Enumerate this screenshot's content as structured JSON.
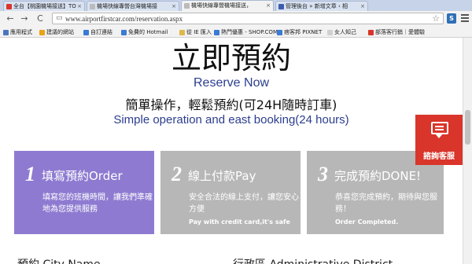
{
  "tabs": [
    {
      "label": "全台【桃園機場接送】TO",
      "color": "#d9352b"
    },
    {
      "label": "機場快線專營台灣機場接",
      "color": "#7a7a7a"
    },
    {
      "label": "機場快線專營機場接送，",
      "color": "#7a7a7a"
    },
    {
      "label": "管理後台 » 新增文章 ‹ 相",
      "color": "#3b5cad"
    }
  ],
  "nav": {
    "back": "←",
    "forward": "→",
    "reload": "C"
  },
  "address": {
    "value": "www.airportfirstcar.com/reservation.aspx",
    "star": "☆",
    "ext_label": "S"
  },
  "bookmarks": [
    {
      "label": "應用程式",
      "color": "#4a76c0"
    },
    {
      "label": "建議的網站",
      "color": "#e8a317"
    },
    {
      "label": "自訂連結",
      "color": "#3a7bd5"
    },
    {
      "label": "免費的 Hotmail",
      "color": "#3a7bd5"
    },
    {
      "label": "從 IE 匯入",
      "color": "#e0b84a"
    },
    {
      "label": "熱門優惠 - SHOP.COM",
      "color": "#3a7bd5"
    },
    {
      "label": "痞客邦 PIXNET",
      "color": "#3a7bd5"
    },
    {
      "label": "女人知己",
      "color": "#d0d0d0"
    },
    {
      "label": "部落客行銷｜愛體驗",
      "color": "#d9352b"
    }
  ],
  "heading": {
    "zh": "立即預約",
    "en": "Reserve Now",
    "sub_zh": "簡單操作，輕鬆預約(可24H隨時訂車)",
    "sub_en": "Simple operation and east booking(24 hours)"
  },
  "steps": [
    {
      "num": "1",
      "title": "填寫預約Order",
      "desc": "填寫您的班機時間，讓我們準確地為您提供服務",
      "en": ""
    },
    {
      "num": "2",
      "title": "線上付款Pay",
      "desc": "安全合法的線上支付，讓您安心方便",
      "en": "Pay with credit card,it's safe"
    },
    {
      "num": "3",
      "title": "完成預約DONE!",
      "desc": "恭喜您完成預約，期待與您服務！",
      "en": "Order Completed."
    }
  ],
  "bottom_cut": {
    "left": "預約 City Name",
    "right": "行政區 Administrative District"
  },
  "chat_label": "諮詢客服"
}
